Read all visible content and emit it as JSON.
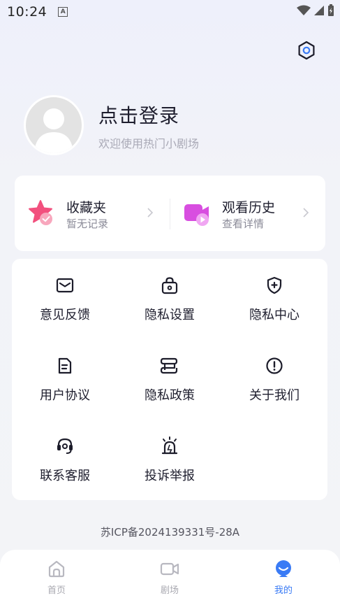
{
  "status_bar": {
    "time": "10:24",
    "notif_icon": "A"
  },
  "header": {
    "login_title": "点击登录",
    "login_subtitle": "欢迎使用热门小剧场"
  },
  "quick": [
    {
      "title": "收藏夹",
      "subtitle": "暂无记录",
      "icon": "star-icon"
    },
    {
      "title": "观看历史",
      "subtitle": "查看详情",
      "icon": "video-history-icon"
    }
  ],
  "menu": [
    {
      "label": "意见反馈",
      "icon": "mail-icon"
    },
    {
      "label": "隐私设置",
      "icon": "lock-bag-icon"
    },
    {
      "label": "隐私中心",
      "icon": "shield-plus-icon"
    },
    {
      "label": "用户协议",
      "icon": "document-icon"
    },
    {
      "label": "隐私政策",
      "icon": "scroll-icon"
    },
    {
      "label": "关于我们",
      "icon": "info-exclamation-icon"
    },
    {
      "label": "联系客服",
      "icon": "headset-icon"
    },
    {
      "label": "投诉举报",
      "icon": "alarm-bell-icon"
    }
  ],
  "icp": "苏ICP备2024139331号-28A",
  "tabs": [
    {
      "label": "首页",
      "icon": "home-icon",
      "active": false
    },
    {
      "label": "剧场",
      "icon": "video-camera-icon",
      "active": false
    },
    {
      "label": "我的",
      "icon": "profile-face-icon",
      "active": true
    }
  ],
  "colors": {
    "accent": "#3a7bf5",
    "star": "#f2507e",
    "video": "#d84ee0"
  }
}
